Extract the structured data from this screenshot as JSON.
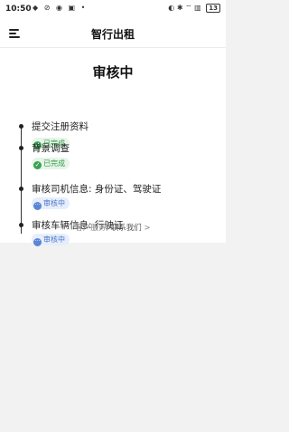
{
  "status_bar": {
    "time": "10:50",
    "left_icons": "◆ ⊘ ◉ ▣ •",
    "right_icons": "◐ ✱ ⌔ ▥",
    "battery": "13"
  },
  "app_bar": {
    "title": "智行出租"
  },
  "page": {
    "title": "审核中"
  },
  "timeline": {
    "steps": [
      {
        "title": "提交注册资料",
        "status": "已完成",
        "status_icon": "✓"
      },
      {
        "title": "背景调查",
        "status": "已完成",
        "status_icon": "✓"
      },
      {
        "title": "审核司机信息: 身份证、驾驶证",
        "status": "审核中",
        "status_icon": "···"
      },
      {
        "title": "审核车辆信息: 行驶证",
        "status": "审核中",
        "status_icon": "···"
      }
    ]
  },
  "contact": {
    "prefix": "客户服务,",
    "link": "联系我们",
    "chevron": ">"
  },
  "colors": {
    "done": "#3aa353",
    "review": "#5b86d6"
  }
}
